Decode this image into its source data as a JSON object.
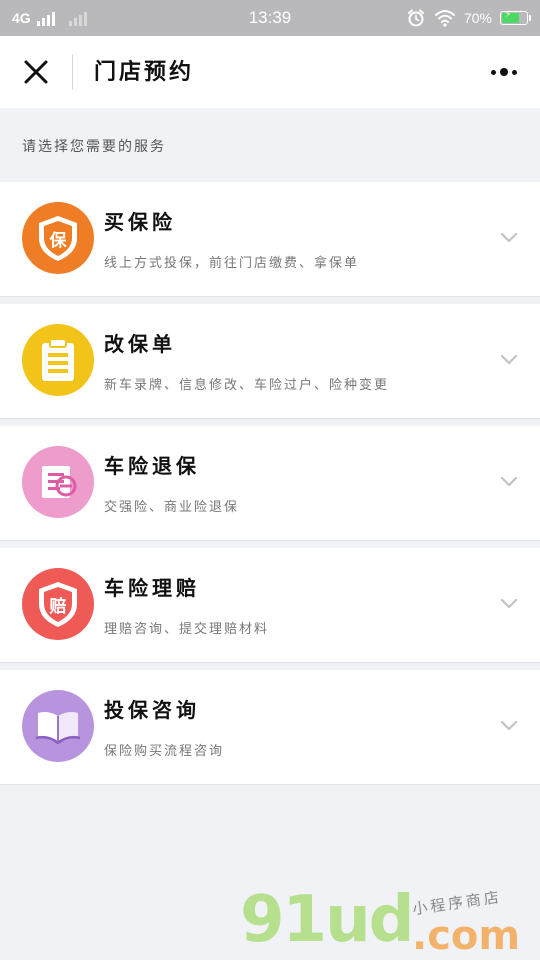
{
  "status_bar": {
    "network": "4G",
    "time": "13:39",
    "battery_percent": "70%",
    "battery_level": 0.7,
    "icons": [
      "alarm-icon",
      "wifi-icon",
      "battery-icon"
    ]
  },
  "nav": {
    "title": "门店预约",
    "close_icon": "close-icon",
    "more_icon": "more-icon"
  },
  "section_header": "请选择您需要的服务",
  "services": [
    {
      "title": "买保险",
      "desc": "线上方式投保，前往门店缴费、拿保单",
      "icon": "shield-bao-icon",
      "icon_color": "#ef7d25"
    },
    {
      "title": "改保单",
      "desc": "新车录牌、信息修改、车险过户、险种变更",
      "icon": "clipboard-icon",
      "icon_color": "#f2c318"
    },
    {
      "title": "车险退保",
      "desc": "交强险、商业险退保",
      "icon": "refund-document-icon",
      "icon_color": "#ee9ccc"
    },
    {
      "title": "车险理赔",
      "desc": "理赔咨询、提交理赔材料",
      "icon": "shield-pei-icon",
      "icon_color": "#ef5a57"
    },
    {
      "title": "投保咨询",
      "desc": "保险购买流程咨询",
      "icon": "open-book-icon",
      "icon_color": "#b894de"
    }
  ],
  "watermark": {
    "main": "91ud",
    "dot": ".com",
    "sub": "小程序商店"
  },
  "colors": {
    "background": "#f1f2f6",
    "status_bar": "#b9b9bb",
    "battery_fill": "#4cd964"
  }
}
